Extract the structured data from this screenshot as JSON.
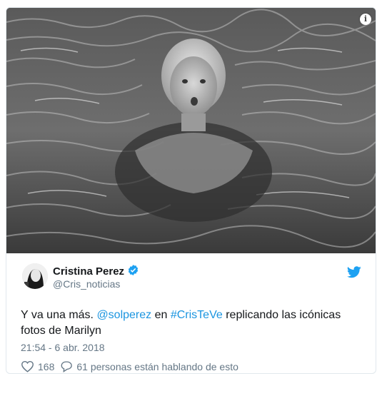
{
  "media": {
    "info_icon": "info-icon",
    "info_symbol": "i"
  },
  "author": {
    "name": "Cristina Perez",
    "handle": "@Cris_noticias",
    "verified_icon": "verified-badge-icon",
    "verified_color": "#1da1f2"
  },
  "brand": {
    "icon": "twitter-bird-icon",
    "color": "#1da1f2"
  },
  "tweet": {
    "text_prefix": "Y va una más. ",
    "mention": "@solperez",
    "text_middle": " en ",
    "hashtag": "#CrisTeVe",
    "text_suffix": " replicando las icónicas fotos de Marilyn",
    "link_color": "#1b95e0",
    "timestamp": "21:54 - 6 abr. 2018"
  },
  "actions": {
    "like_icon": "heart-icon",
    "like_count": "168",
    "reply_icon": "comment-icon",
    "conversation_text": "61 personas están hablando de esto"
  }
}
